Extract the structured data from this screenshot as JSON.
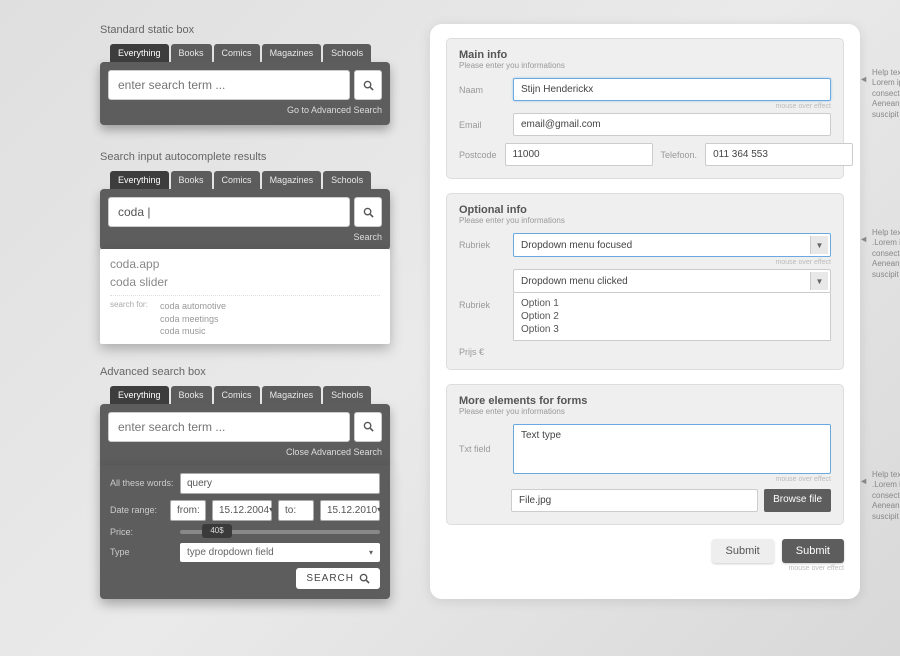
{
  "left": {
    "standard_title": "Standard static box",
    "tabs": [
      "Everything",
      "Books",
      "Comics",
      "Magazines",
      "Schools"
    ],
    "search_placeholder": "enter search term ...",
    "advanced_link": "Go to Advanced Search",
    "ac_title": "Search input autocomplete results",
    "ac_value": "coda |",
    "ac_search_label": "Search",
    "ac_big": [
      "coda.app",
      "coda slider"
    ],
    "ac_small_label": "search for:",
    "ac_small": [
      "coda automotive",
      "coda meetings",
      "coda music"
    ],
    "adv_title": "Advanced search box",
    "close_adv": "Close Advanced Search",
    "adv": {
      "all_words_label": "All these words:",
      "all_words_value": "query",
      "date_label": "Date range:",
      "from": "from:",
      "date_from": "15.12.2004",
      "to": "to:",
      "date_to": "15.12.2010",
      "price_label": "Price:",
      "price_value": "40$",
      "type_label": "Type",
      "type_value": "type dropdown field",
      "search_btn": "SEARCH"
    }
  },
  "right": {
    "main": {
      "title": "Main info",
      "sub": "Please enter you informations",
      "naam_label": "Naam",
      "naam_value": "Stijn Henderickx",
      "email_label": "Email",
      "email_value": "email@gmail.com",
      "postcode_label": "Postcode",
      "postcode_value": "11000",
      "tele_label": "Telefoon.",
      "tele_value": "011 364 553"
    },
    "help1": "Help text. Display on hover . Lorem ipsum dolor sit amet, consecte-tur adipiscing elit. Aenean in eros ut purus suscipit cursus.",
    "opt": {
      "title": "Optional info",
      "sub": "Please enter you informations",
      "rubriek_label": "Rubriek",
      "dd_focused": "Dropdown menu focused",
      "dd_clicked": "Dropdown menu clicked",
      "options": [
        "Option 1",
        "Option 2",
        "Option 3"
      ],
      "prijs_label": "Prijs €"
    },
    "help2": "Help text. Display on hover .Lorem ipsum dolor sit amet, consecte-tur adipiscing elit. Aenean in eros ut purus suscipit cursus.",
    "more": {
      "title": "More elements for forms",
      "sub": "Please enter you informations",
      "txt_label": "Txt field",
      "txt_value": "Text type",
      "mouse_effect": "mouse over effect",
      "file_value": "File.jpg",
      "file_btn": "Browse file"
    },
    "help3": "Help text. Display on hover .Lorem ipsum dolor sit amet, consectetur adipiscing elit. Aenean in eros ut purus suscipit cursus.",
    "submit1": "Submit",
    "submit2": "Submit"
  }
}
